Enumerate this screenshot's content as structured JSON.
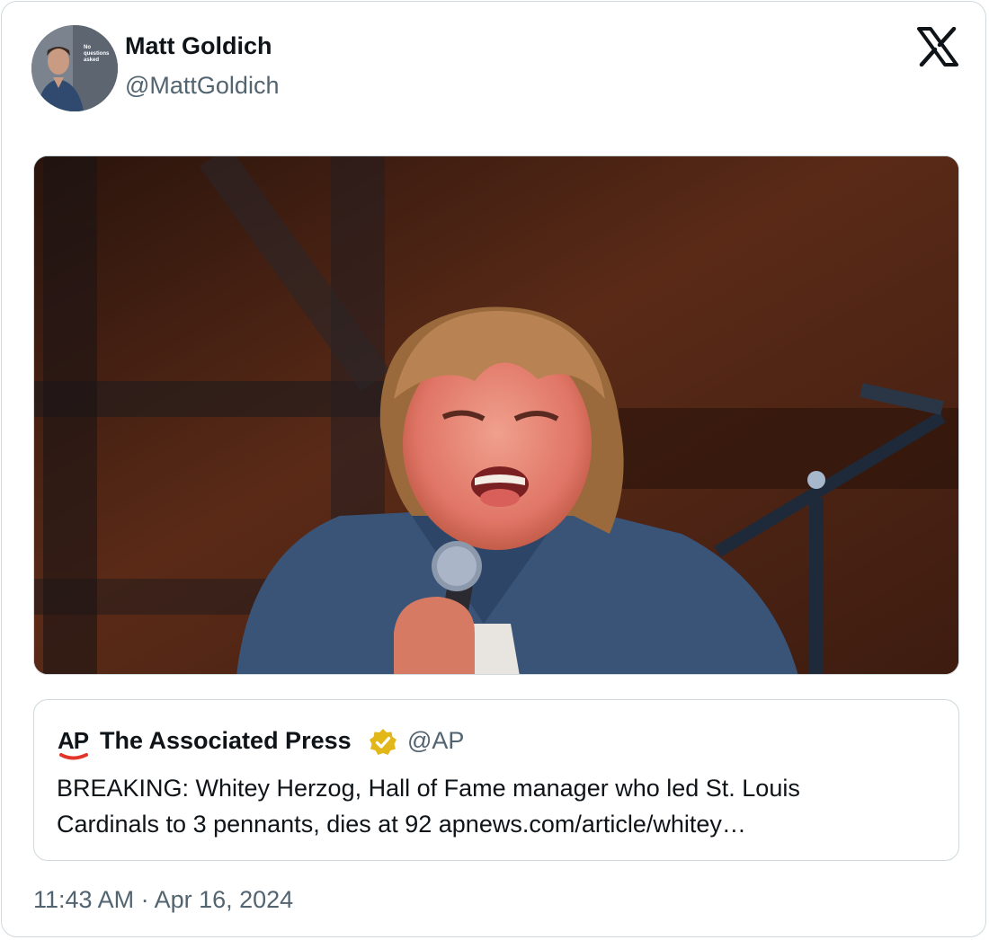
{
  "author": {
    "name": "Matt Goldich",
    "handle": "@MattGoldich",
    "avatar_icon": "profile-photo"
  },
  "brand_icon": "x-logo-icon",
  "quoted_post": {
    "logo_text": "AP",
    "name": "The Associated Press",
    "verified_icon": "verified-badge-icon",
    "verified_color": "#e2b719",
    "handle": "@AP",
    "text_line_1": "BREAKING: Whitey Herzog, Hall of Fame manager who led St. Louis",
    "text_line_2": "Cardinals to 3 pennants, dies at 92 apnews.com/article/whitey…"
  },
  "timestamp": "11:43 AM · Apr 16, 2024",
  "colors": {
    "text_primary": "#0f1419",
    "text_secondary": "#536471",
    "border": "#cfd9de",
    "ap_red": "#e1352a"
  }
}
